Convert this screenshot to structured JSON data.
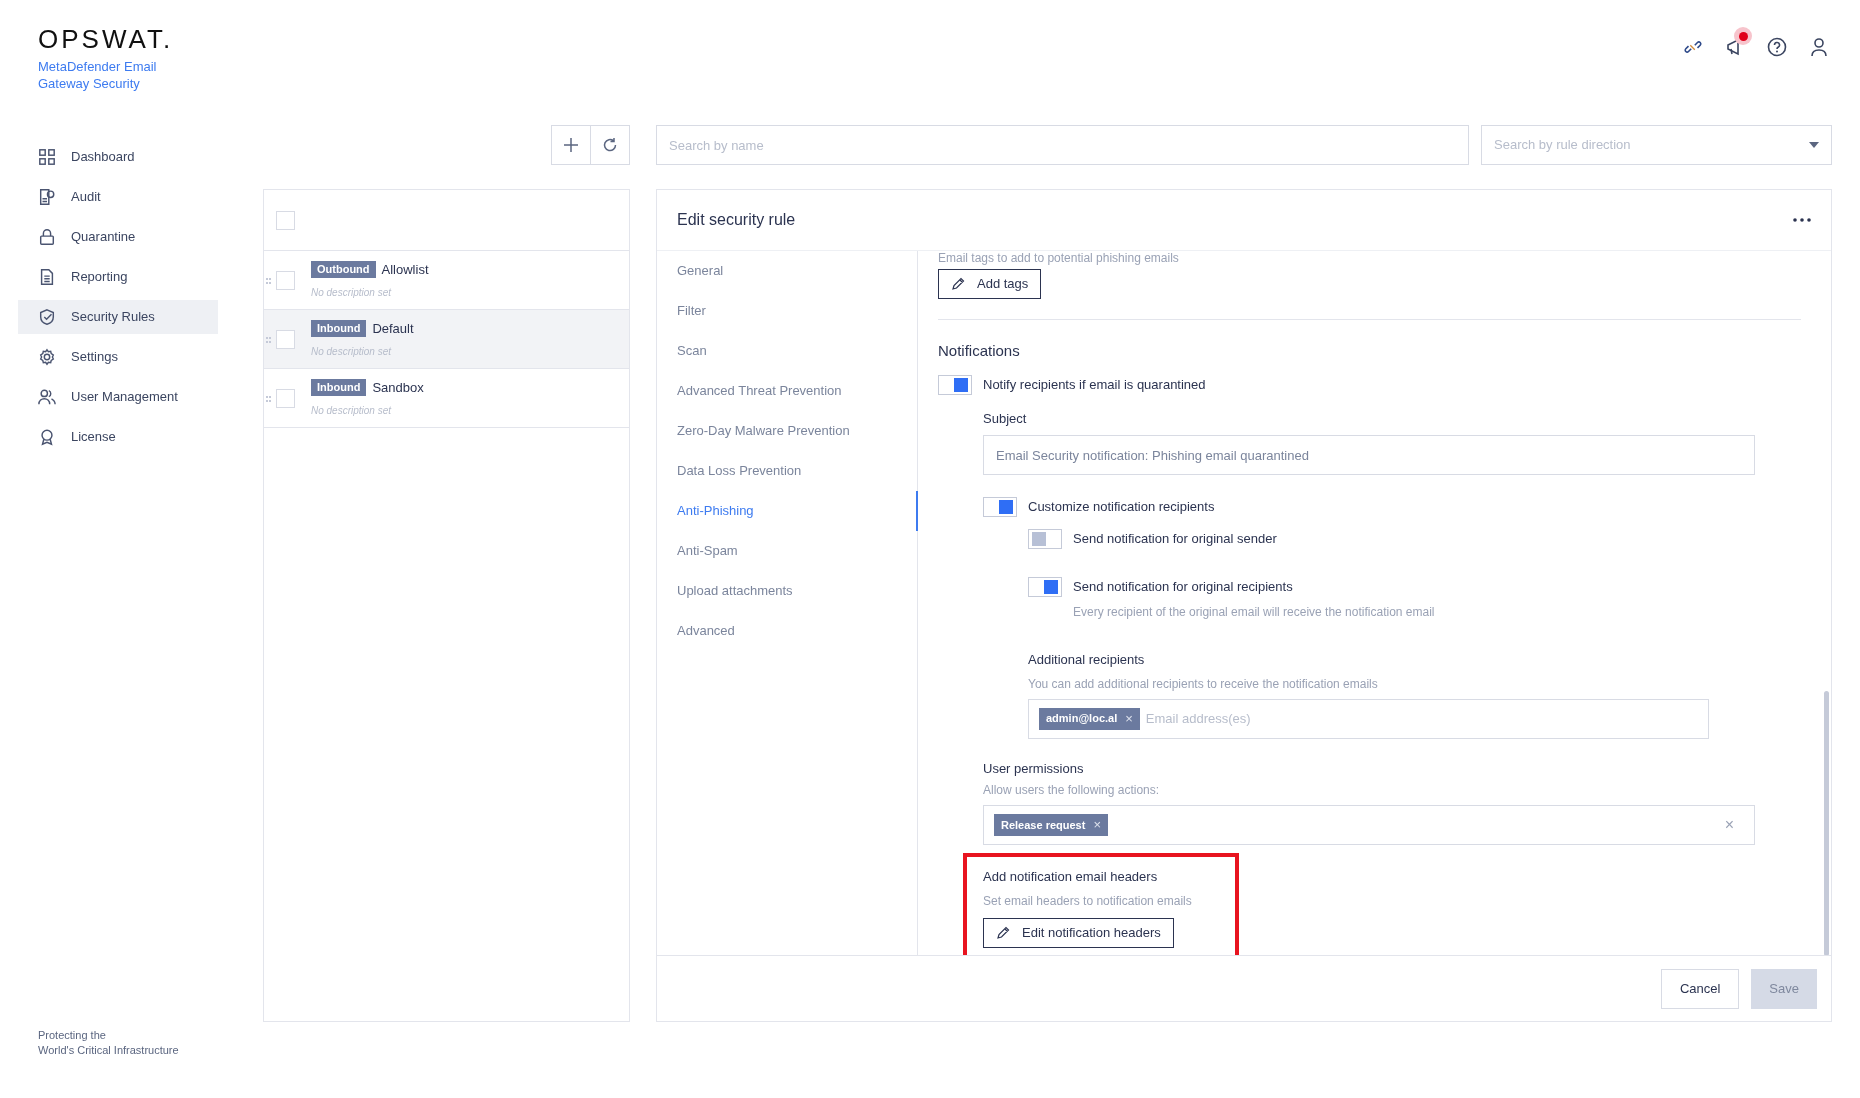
{
  "brand": {
    "logo": "OPSWAT.",
    "product": "MetaDefender Email Gateway Security",
    "tagline": [
      "Protecting the",
      "World's Critical Infrastructure"
    ]
  },
  "header_icons": [
    {
      "kind": "unlink"
    },
    {
      "kind": "notifications",
      "badge": true
    },
    {
      "kind": "help"
    },
    {
      "kind": "user"
    }
  ],
  "sidebar": {
    "items": [
      {
        "label": "Dashboard",
        "selected": false
      },
      {
        "label": "Audit",
        "selected": false
      },
      {
        "label": "Quarantine",
        "selected": false
      },
      {
        "label": "Reporting",
        "selected": false
      },
      {
        "label": "Security Rules",
        "selected": true
      },
      {
        "label": "Settings",
        "selected": false
      },
      {
        "label": "User Management",
        "selected": false
      },
      {
        "label": "License",
        "selected": false
      }
    ]
  },
  "select_all": {
    "checked": false
  },
  "search": {
    "placeholder": "Search by name"
  },
  "direction_filter": {
    "placeholder": "Search by rule direction"
  },
  "rules": [
    {
      "direction": "Outbound",
      "name": "Allowlist",
      "description": "No description set",
      "selected": false,
      "checked": false
    },
    {
      "direction": "Inbound",
      "name": "Default",
      "description": "No description set",
      "selected": true,
      "checked": false
    },
    {
      "direction": "Inbound",
      "name": "Sandbox",
      "description": "No description set",
      "selected": false,
      "checked": false
    }
  ],
  "editor": {
    "title": "Edit security rule",
    "tabs": [
      {
        "label": "General",
        "selected": false
      },
      {
        "label": "Filter",
        "selected": false
      },
      {
        "label": "Scan",
        "selected": false
      },
      {
        "label": "Advanced Threat Prevention",
        "selected": false
      },
      {
        "label": "Zero-Day Malware Prevention",
        "selected": false
      },
      {
        "label": "Data Loss Prevention",
        "selected": false
      },
      {
        "label": "Anti-Phishing",
        "selected": true
      },
      {
        "label": "Anti-Spam",
        "selected": false
      },
      {
        "label": "Upload attachments",
        "selected": false
      },
      {
        "label": "Advanced",
        "selected": false
      }
    ],
    "tags_hint": "Email tags to add to potential phishing emails",
    "add_tags_button": "Add tags",
    "notifications_heading": "Notifications",
    "notify_toggle": {
      "label": "Notify recipients if email is quarantined",
      "on": true
    },
    "subject": {
      "label": "Subject",
      "placeholder": "Email Security notification: Phishing email quarantined"
    },
    "customize_toggle": {
      "label": "Customize notification recipients",
      "on": true
    },
    "sender_toggle": {
      "label": "Send notification for original sender",
      "on": false
    },
    "recipients_toggle": {
      "label": "Send notification for original recipients",
      "on": true,
      "hint": "Every recipient of the original email will receive the notification email"
    },
    "additional_recipients": {
      "label": "Additional recipients",
      "hint": "You can add additional recipients to receive the notification emails",
      "chips": [
        "admin@loc.al"
      ],
      "chip_remove": "×",
      "placeholder": "Email address(es)"
    },
    "user_permissions": {
      "label": "User permissions",
      "hint": "Allow users the following actions:",
      "chips": [
        "Release request"
      ],
      "chip_remove": "×",
      "clear": "×"
    },
    "headers": {
      "label": "Add notification email headers",
      "hint": "Set email headers to notification emails",
      "button": "Edit notification headers"
    },
    "cancel_button": "Cancel",
    "save_button": {
      "label": "Save",
      "disabled": true
    }
  }
}
